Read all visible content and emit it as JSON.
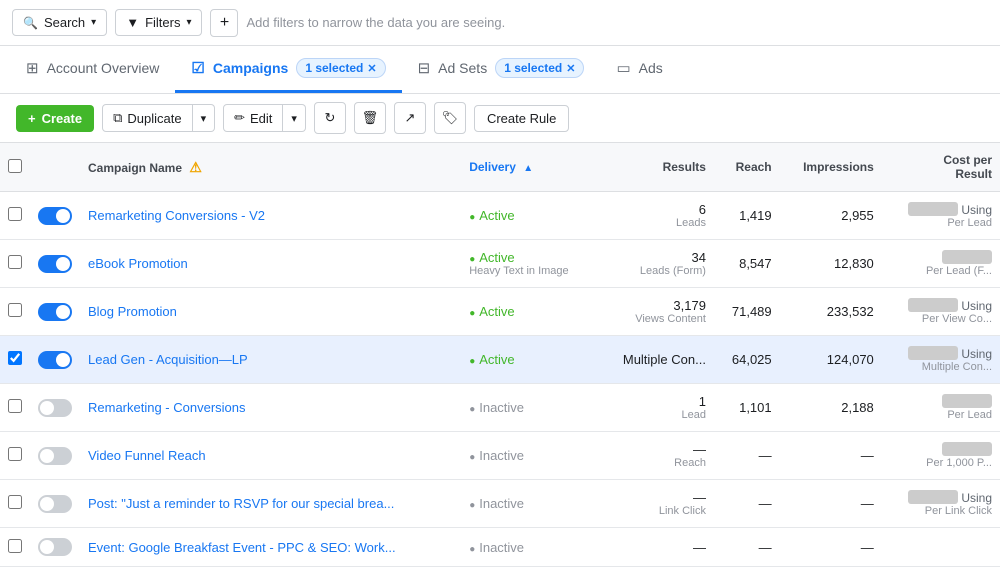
{
  "topbar": {
    "search_label": "Search",
    "filters_label": "Filters",
    "add_filter_hint": "Add filters to narrow the data you are seeing."
  },
  "tabs": [
    {
      "id": "account-overview",
      "label": "Account Overview",
      "icon": "⊞",
      "active": false,
      "badge": null
    },
    {
      "id": "campaigns",
      "label": "Campaigns",
      "icon": "✓",
      "active": true,
      "badge": "1 selected"
    },
    {
      "id": "ad-sets",
      "label": "Ad Sets",
      "icon": "⊟",
      "active": false,
      "badge": "1 selected"
    },
    {
      "id": "ads",
      "label": "Ads",
      "icon": "▭",
      "active": false,
      "badge": null
    }
  ],
  "toolbar": {
    "create_label": "+ Create",
    "duplicate_label": "Duplicate",
    "edit_label": "Edit",
    "create_rule_label": "Create Rule"
  },
  "table": {
    "columns": [
      {
        "id": "campaign-name",
        "label": "Campaign Name",
        "sortable": false
      },
      {
        "id": "delivery",
        "label": "Delivery",
        "sortable": true
      },
      {
        "id": "results",
        "label": "Results",
        "sortable": false
      },
      {
        "id": "reach",
        "label": "Reach",
        "sortable": false
      },
      {
        "id": "impressions",
        "label": "Impressions",
        "sortable": false
      },
      {
        "id": "cost-per-result",
        "label": "Cost per Result",
        "sortable": false
      }
    ],
    "rows": [
      {
        "id": 1,
        "checked": false,
        "toggle": true,
        "selected": false,
        "name": "Remarketing Conversions - V2",
        "delivery": "Active",
        "delivery_sub": "",
        "results": "6",
        "results_sub": "Leads",
        "reach": "1,419",
        "impressions": "2,955",
        "cost_blurred": true,
        "cost_sub": "Per Lead",
        "cost_label": "Using"
      },
      {
        "id": 2,
        "checked": false,
        "toggle": true,
        "selected": false,
        "name": "eBook Promotion",
        "delivery": "Active",
        "delivery_sub": "Heavy Text in Image",
        "results": "34",
        "results_sub": "Leads (Form)",
        "reach": "8,547",
        "impressions": "12,830",
        "cost_blurred": true,
        "cost_sub": "Per Lead (F...",
        "cost_label": ""
      },
      {
        "id": 3,
        "checked": false,
        "toggle": true,
        "selected": false,
        "name": "Blog Promotion",
        "delivery": "Active",
        "delivery_sub": "",
        "results": "3,179",
        "results_sub": "Views Content",
        "reach": "71,489",
        "impressions": "233,532",
        "cost_blurred": true,
        "cost_sub": "Per View Co...",
        "cost_label": "Using"
      },
      {
        "id": 4,
        "checked": true,
        "toggle": true,
        "selected": true,
        "name": "Lead Gen - Acquisition—LP",
        "delivery": "Active",
        "delivery_sub": "",
        "results": "Multiple Con...",
        "results_sub": "",
        "reach": "64,025",
        "impressions": "124,070",
        "cost_blurred": true,
        "cost_sub": "Multiple Con...",
        "cost_label": "Using"
      },
      {
        "id": 5,
        "checked": false,
        "toggle": false,
        "selected": false,
        "name": "Remarketing - Conversions",
        "delivery": "Inactive",
        "delivery_sub": "",
        "results": "1",
        "results_sub": "Lead",
        "reach": "1,101",
        "impressions": "2,188",
        "cost_blurred": true,
        "cost_sub": "Per Lead",
        "cost_label": ""
      },
      {
        "id": 6,
        "checked": false,
        "toggle": false,
        "selected": false,
        "name": "Video Funnel Reach",
        "delivery": "Inactive",
        "delivery_sub": "",
        "results": "—",
        "results_sub": "Reach",
        "reach": "—",
        "impressions": "—",
        "cost_blurred": true,
        "cost_sub": "Per 1,000 P...",
        "cost_label": ""
      },
      {
        "id": 7,
        "checked": false,
        "toggle": false,
        "selected": false,
        "name": "Post: \"Just a reminder to RSVP for our special brea...",
        "delivery": "Inactive",
        "delivery_sub": "",
        "results": "—",
        "results_sub": "Link Click",
        "reach": "—",
        "impressions": "—",
        "cost_blurred": true,
        "cost_sub": "Per Link Click",
        "cost_label": "Using"
      },
      {
        "id": 8,
        "checked": false,
        "toggle": false,
        "selected": false,
        "name": "Event: Google Breakfast Event - PPC & SEO: Work...",
        "delivery": "Inactive",
        "delivery_sub": "",
        "results": "—",
        "results_sub": "",
        "reach": "—",
        "impressions": "—",
        "cost_blurred": false,
        "cost_sub": "",
        "cost_label": ""
      }
    ]
  }
}
